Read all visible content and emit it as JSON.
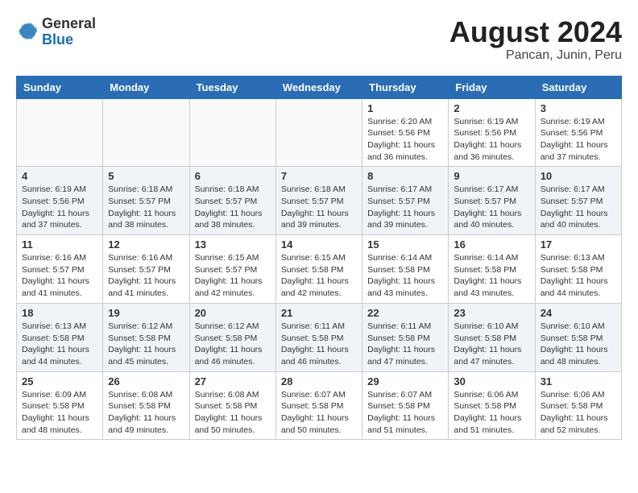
{
  "header": {
    "logo_general": "General",
    "logo_blue": "Blue",
    "month": "August 2024",
    "location": "Pancan, Junin, Peru"
  },
  "weekdays": [
    "Sunday",
    "Monday",
    "Tuesday",
    "Wednesday",
    "Thursday",
    "Friday",
    "Saturday"
  ],
  "weeks": [
    [
      {
        "day": "",
        "info": ""
      },
      {
        "day": "",
        "info": ""
      },
      {
        "day": "",
        "info": ""
      },
      {
        "day": "",
        "info": ""
      },
      {
        "day": "1",
        "info": "Sunrise: 6:20 AM\nSunset: 5:56 PM\nDaylight: 11 hours\nand 36 minutes."
      },
      {
        "day": "2",
        "info": "Sunrise: 6:19 AM\nSunset: 5:56 PM\nDaylight: 11 hours\nand 36 minutes."
      },
      {
        "day": "3",
        "info": "Sunrise: 6:19 AM\nSunset: 5:56 PM\nDaylight: 11 hours\nand 37 minutes."
      }
    ],
    [
      {
        "day": "4",
        "info": "Sunrise: 6:19 AM\nSunset: 5:56 PM\nDaylight: 11 hours\nand 37 minutes."
      },
      {
        "day": "5",
        "info": "Sunrise: 6:18 AM\nSunset: 5:57 PM\nDaylight: 11 hours\nand 38 minutes."
      },
      {
        "day": "6",
        "info": "Sunrise: 6:18 AM\nSunset: 5:57 PM\nDaylight: 11 hours\nand 38 minutes."
      },
      {
        "day": "7",
        "info": "Sunrise: 6:18 AM\nSunset: 5:57 PM\nDaylight: 11 hours\nand 39 minutes."
      },
      {
        "day": "8",
        "info": "Sunrise: 6:17 AM\nSunset: 5:57 PM\nDaylight: 11 hours\nand 39 minutes."
      },
      {
        "day": "9",
        "info": "Sunrise: 6:17 AM\nSunset: 5:57 PM\nDaylight: 11 hours\nand 40 minutes."
      },
      {
        "day": "10",
        "info": "Sunrise: 6:17 AM\nSunset: 5:57 PM\nDaylight: 11 hours\nand 40 minutes."
      }
    ],
    [
      {
        "day": "11",
        "info": "Sunrise: 6:16 AM\nSunset: 5:57 PM\nDaylight: 11 hours\nand 41 minutes."
      },
      {
        "day": "12",
        "info": "Sunrise: 6:16 AM\nSunset: 5:57 PM\nDaylight: 11 hours\nand 41 minutes."
      },
      {
        "day": "13",
        "info": "Sunrise: 6:15 AM\nSunset: 5:57 PM\nDaylight: 11 hours\nand 42 minutes."
      },
      {
        "day": "14",
        "info": "Sunrise: 6:15 AM\nSunset: 5:58 PM\nDaylight: 11 hours\nand 42 minutes."
      },
      {
        "day": "15",
        "info": "Sunrise: 6:14 AM\nSunset: 5:58 PM\nDaylight: 11 hours\nand 43 minutes."
      },
      {
        "day": "16",
        "info": "Sunrise: 6:14 AM\nSunset: 5:58 PM\nDaylight: 11 hours\nand 43 minutes."
      },
      {
        "day": "17",
        "info": "Sunrise: 6:13 AM\nSunset: 5:58 PM\nDaylight: 11 hours\nand 44 minutes."
      }
    ],
    [
      {
        "day": "18",
        "info": "Sunrise: 6:13 AM\nSunset: 5:58 PM\nDaylight: 11 hours\nand 44 minutes."
      },
      {
        "day": "19",
        "info": "Sunrise: 6:12 AM\nSunset: 5:58 PM\nDaylight: 11 hours\nand 45 minutes."
      },
      {
        "day": "20",
        "info": "Sunrise: 6:12 AM\nSunset: 5:58 PM\nDaylight: 11 hours\nand 46 minutes."
      },
      {
        "day": "21",
        "info": "Sunrise: 6:11 AM\nSunset: 5:58 PM\nDaylight: 11 hours\nand 46 minutes."
      },
      {
        "day": "22",
        "info": "Sunrise: 6:11 AM\nSunset: 5:58 PM\nDaylight: 11 hours\nand 47 minutes."
      },
      {
        "day": "23",
        "info": "Sunrise: 6:10 AM\nSunset: 5:58 PM\nDaylight: 11 hours\nand 47 minutes."
      },
      {
        "day": "24",
        "info": "Sunrise: 6:10 AM\nSunset: 5:58 PM\nDaylight: 11 hours\nand 48 minutes."
      }
    ],
    [
      {
        "day": "25",
        "info": "Sunrise: 6:09 AM\nSunset: 5:58 PM\nDaylight: 11 hours\nand 48 minutes."
      },
      {
        "day": "26",
        "info": "Sunrise: 6:08 AM\nSunset: 5:58 PM\nDaylight: 11 hours\nand 49 minutes."
      },
      {
        "day": "27",
        "info": "Sunrise: 6:08 AM\nSunset: 5:58 PM\nDaylight: 11 hours\nand 50 minutes."
      },
      {
        "day": "28",
        "info": "Sunrise: 6:07 AM\nSunset: 5:58 PM\nDaylight: 11 hours\nand 50 minutes."
      },
      {
        "day": "29",
        "info": "Sunrise: 6:07 AM\nSunset: 5:58 PM\nDaylight: 11 hours\nand 51 minutes."
      },
      {
        "day": "30",
        "info": "Sunrise: 6:06 AM\nSunset: 5:58 PM\nDaylight: 11 hours\nand 51 minutes."
      },
      {
        "day": "31",
        "info": "Sunrise: 6:06 AM\nSunset: 5:58 PM\nDaylight: 11 hours\nand 52 minutes."
      }
    ]
  ]
}
